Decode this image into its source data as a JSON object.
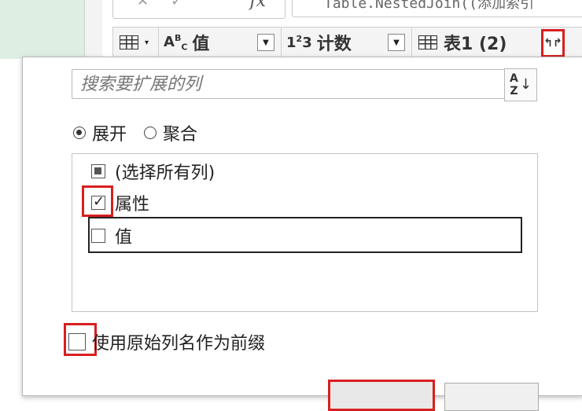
{
  "formula_bar": {
    "fx_label": "fx",
    "text": "Table.NestedJoin((添加索引"
  },
  "column_headers": [
    {
      "type_icon": "ABC",
      "label": "值"
    },
    {
      "type_icon": "123",
      "label": "计数"
    },
    {
      "type_icon": "table-icon",
      "label": "表1 (2)"
    }
  ],
  "expand_dialog": {
    "search_placeholder": "搜索要扩展的列",
    "sort_label_top": "A",
    "sort_label_bottom": "Z",
    "mode_options": [
      {
        "label": "展开",
        "selected": true
      },
      {
        "label": "聚合",
        "selected": false
      }
    ],
    "columns": [
      {
        "label": "(选择所有列)",
        "state": "partial"
      },
      {
        "label": "属性",
        "state": "checked"
      },
      {
        "label": "值",
        "state": "unchecked"
      }
    ],
    "prefix_checkbox": {
      "label": "使用原始列名作为前缀",
      "checked": false
    }
  },
  "colors": {
    "highlight": "#d81f1f",
    "accent_bg": "#dfeee3"
  }
}
